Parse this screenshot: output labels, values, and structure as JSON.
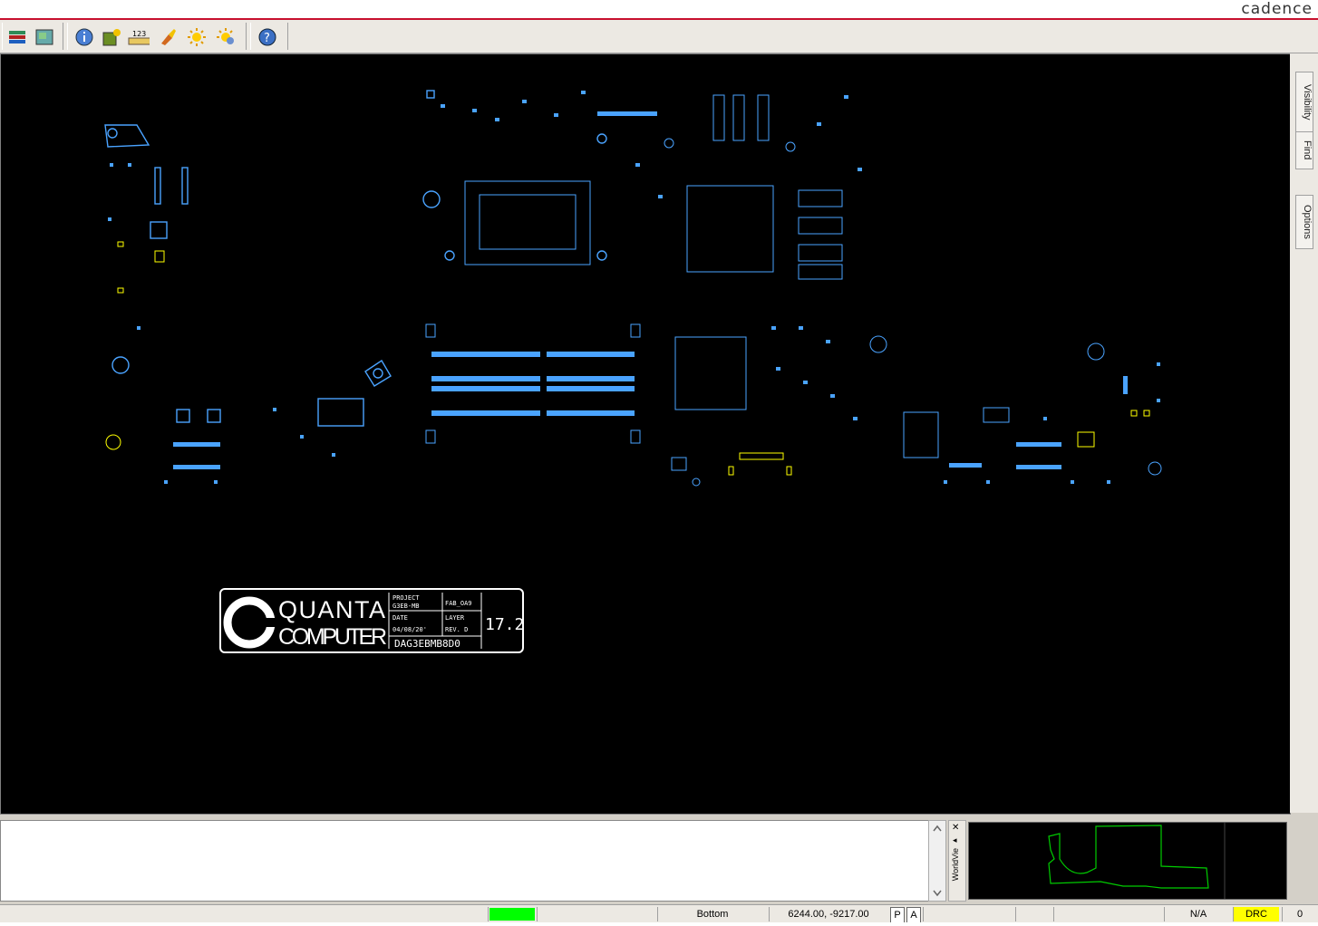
{
  "brand": {
    "name": "cadence",
    "color": "#c8102e"
  },
  "toolbar": {
    "buttons": [
      {
        "icon": "layers-icon"
      },
      {
        "icon": "world-view-icon"
      },
      {
        "icon": "info-icon"
      },
      {
        "icon": "properties-icon"
      },
      {
        "icon": "measure-123-icon"
      },
      {
        "icon": "highlight-brush-icon"
      },
      {
        "icon": "sun-highlight-icon"
      },
      {
        "icon": "sun-dehighlight-icon"
      },
      {
        "icon": "help-icon"
      }
    ],
    "measure_label": "123"
  },
  "side_tabs": {
    "visibility": "Visibility",
    "find": "Find",
    "options": "Options"
  },
  "board": {
    "trace_color": "#4aa3ff",
    "highlight_color": "#ffff00",
    "logo": {
      "line1": "QUANTA",
      "line2": "COMPUTER",
      "project_label": "PROJECT",
      "project_value": "G3EB-MB",
      "fab_label": "FAB_OA9",
      "date_label": "DATE",
      "date_value": "04/08/20'",
      "layer_label": "LAYER",
      "rev_label": "REV. D",
      "part_number": "DAG3EBMB8D0",
      "version": "17.2"
    }
  },
  "world_view": {
    "label": "WorldVie",
    "outline_color": "#00cc00"
  },
  "status": {
    "indicator_color": "#00ff00",
    "layer": "Bottom",
    "coords": "6244.00, -9217.00",
    "p_button": "P",
    "a_button": "A",
    "na": "N/A",
    "drc": "DRC",
    "drc_color": "#ffff00",
    "count": "0"
  }
}
